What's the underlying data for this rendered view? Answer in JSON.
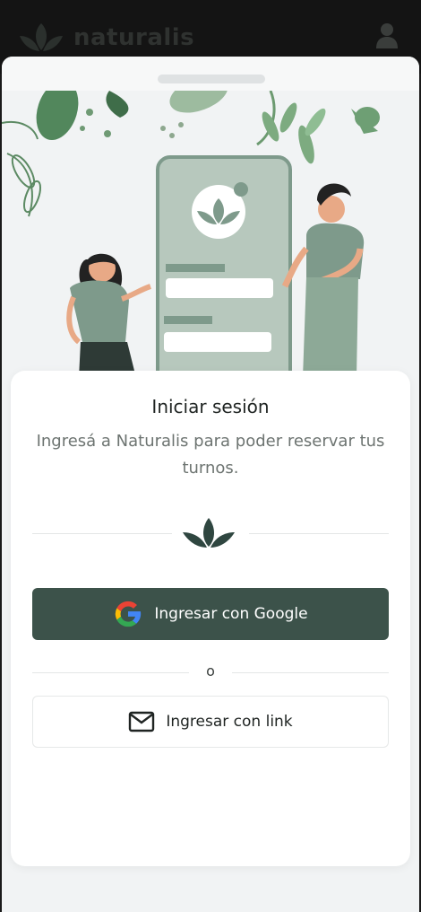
{
  "header": {
    "brand_name": "naturalis",
    "logo_icon": "leaf-logo-icon",
    "user_icon": "user-icon"
  },
  "login": {
    "title": "Iniciar sesión",
    "subtitle": "Ingresá a Naturalis para poder reservar tus turnos.",
    "google_button": "Ingresar con Google",
    "separator": "o",
    "link_button": "Ingresar con link"
  },
  "colors": {
    "primary": "#3c524a",
    "accent_green": "#7e9a8b",
    "background": "#f1f3f4"
  }
}
